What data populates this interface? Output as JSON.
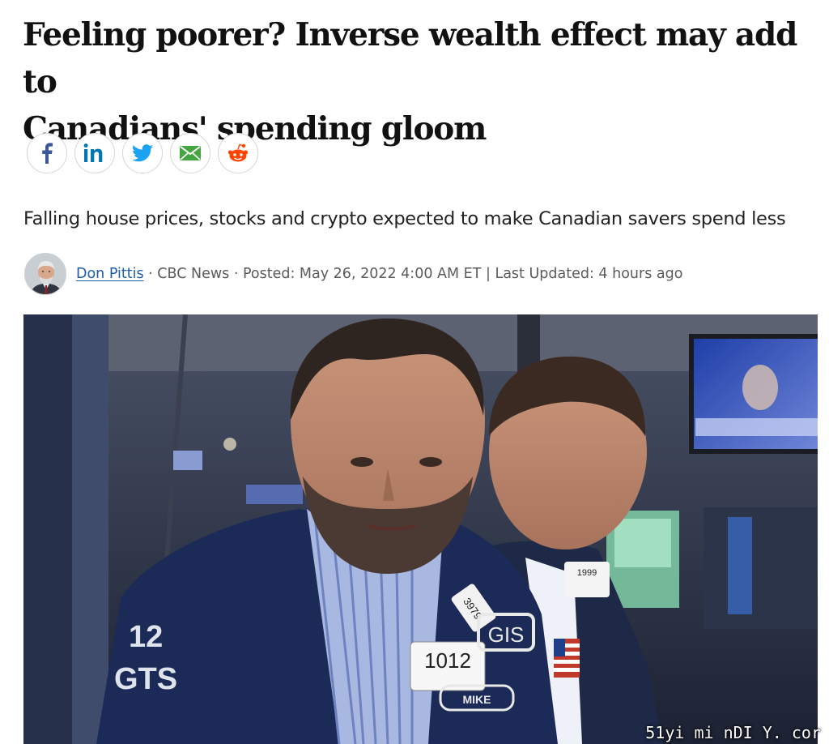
{
  "article": {
    "headline_line1": "Feeling poorer? Inverse wealth effect may add to",
    "headline_line2": "Canadians' spending gloom",
    "deck": "Falling house prices, stocks and crypto expected to make Canadian savers spend less",
    "byline": {
      "author": "Don Pittis",
      "sep1": " · ",
      "outlet": "CBC News",
      "sep2": " · ",
      "posted": "Posted: May 26, 2022 4:00 AM ET",
      "sep3": " | ",
      "updated": "Last Updated: 4 hours ago"
    }
  },
  "share": {
    "buttons": [
      {
        "icon": "facebook-icon",
        "color": "#3b5998"
      },
      {
        "icon": "linkedin-icon",
        "color": "#0077b5"
      },
      {
        "icon": "twitter-icon",
        "color": "#1da1f2"
      },
      {
        "icon": "email-icon",
        "color": "#44a641"
      },
      {
        "icon": "reddit-icon",
        "color": "#ff4500"
      }
    ]
  },
  "photo": {
    "badge_main": "1012",
    "badge_small": "3979",
    "badge_right": "1999",
    "jacket_text": "GIS",
    "sleeve_number": "12",
    "sleeve_text": "GTS",
    "name_tag": "MIKE"
  },
  "watermark": "51yi mi nDI Y. cor"
}
